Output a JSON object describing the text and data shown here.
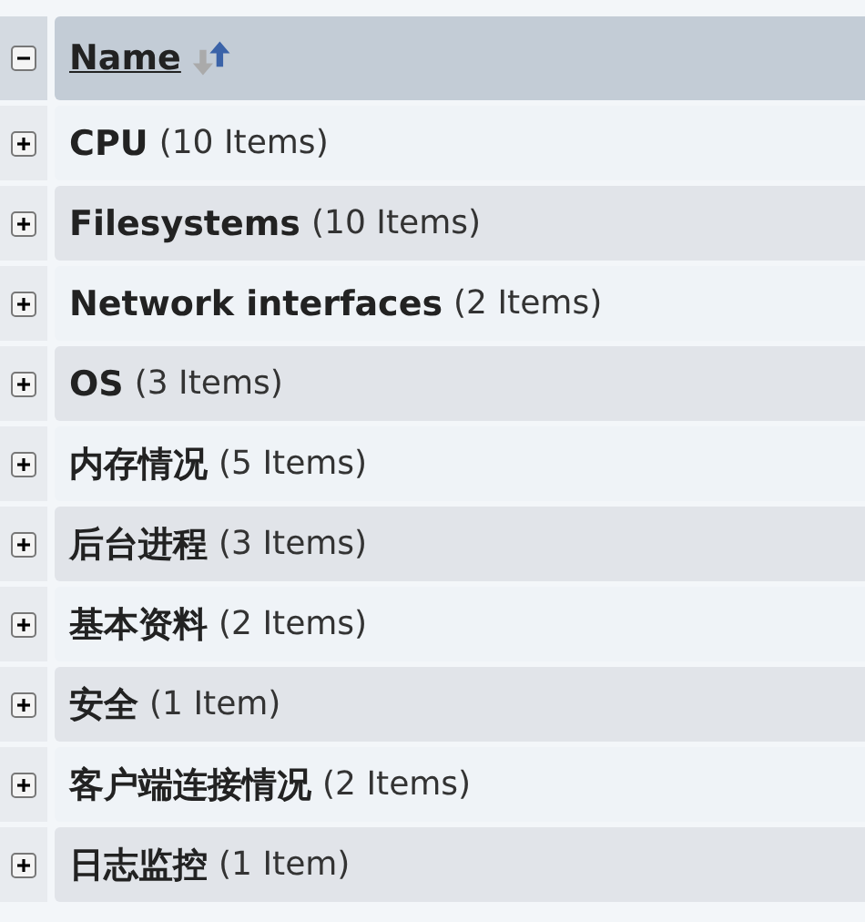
{
  "header": {
    "expanded": true,
    "label": "Name",
    "sort_ascending": true
  },
  "groups": [
    {
      "name": "CPU",
      "count": "(10 Items)",
      "expanded": false
    },
    {
      "name": "Filesystems",
      "count": "(10 Items)",
      "expanded": false
    },
    {
      "name": "Network interfaces",
      "count": "(2 Items)",
      "expanded": false
    },
    {
      "name": "OS",
      "count": "(3 Items)",
      "expanded": false
    },
    {
      "name": "内存情况",
      "count": "(5 Items)",
      "expanded": false
    },
    {
      "name": "后台进程",
      "count": "(3 Items)",
      "expanded": false
    },
    {
      "name": "基本资料",
      "count": "(2 Items)",
      "expanded": false
    },
    {
      "name": "安全",
      "count": "(1 Item)",
      "expanded": false
    },
    {
      "name": "客户端连接情况",
      "count": "(2 Items)",
      "expanded": false
    },
    {
      "name": "日志监控",
      "count": "(1 Item)",
      "expanded": false
    }
  ]
}
